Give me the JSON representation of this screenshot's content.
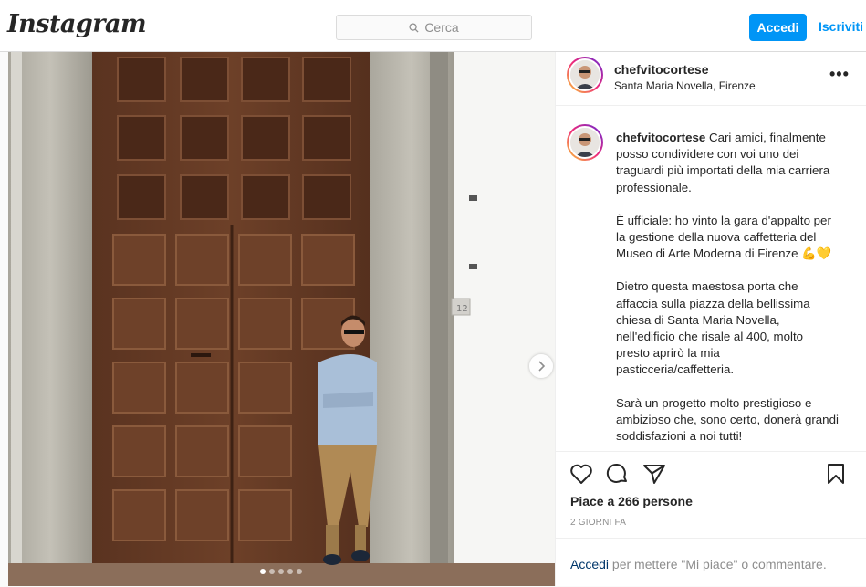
{
  "topbar": {
    "logo": "Instagram",
    "search_placeholder": "Cerca",
    "login_label": "Accedi",
    "signup_label": "Iscriviti"
  },
  "post": {
    "username": "chefvitocortese",
    "location": "Santa Maria Novella, Firenze",
    "more_label": "•••",
    "caption_paragraphs": [
      "Cari amici, finalmente posso condividere con voi uno dei traguardi più importati della mia carriera professionale.",
      "È ufficiale: ho vinto la gara d'appalto per la gestione della nuova caffetteria del Museo di Arte Moderna di Firenze 💪💛",
      "Dietro questa maestosa porta che affaccia sulla piazza della bellissima chiesa di Santa Maria Novella, nell'edificio che risale al 400, molto presto aprirò la mia pasticceria/caffetteria.",
      "Sarà un progetto molto prestigioso e ambizioso che, sono certo, donerà grandi soddisfazioni a noi tutti!"
    ],
    "likes_text": "Piace a 266 persone",
    "time_text": "2 GIORNI FA",
    "login_link": "Accedi",
    "login_rest": " per mettere \"Mi piace\" o commentare.",
    "carousel_count": 5,
    "carousel_index": 0,
    "door_number": "12"
  },
  "icons": {
    "like": "heart-icon",
    "comment": "comment-icon",
    "share": "share-icon",
    "save": "bookmark-icon",
    "search": "search-icon",
    "next": "chevron-right-icon"
  },
  "colors": {
    "accent": "#0095f6",
    "link_dark": "#00376b",
    "muted": "#8e8e8e"
  }
}
